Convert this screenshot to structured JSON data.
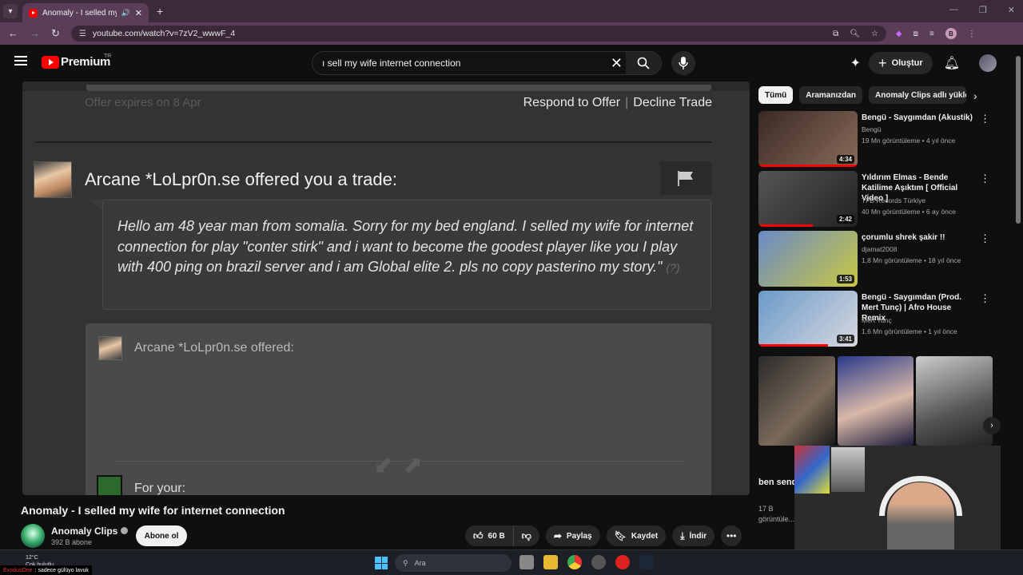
{
  "browser": {
    "tab_title": "Anomaly - I selled my wife",
    "url": "youtube.com/watch?v=7zV2_wwwF_4",
    "profile_initial": "B"
  },
  "yt": {
    "logo": "Premium",
    "region": "TR",
    "search_value": "ı sell my wife internet connection",
    "create_label": "Oluştur"
  },
  "video_frame": {
    "offer_expires": "Offer expires on 8 Apr",
    "respond": "Respond to Offer",
    "decline": "Decline Trade",
    "trade_title": "Arcane *LoLpr0n.se offered you a trade:",
    "message": "Hello am 48 year man from somalia. Sorry for my bed england. I selled my wife for internet connection for play \"conter stirk\" and i want to become the goodest player like you I play with 400 ping on brazil server and i am Global elite 2. pls no copy pasterino my story.\"",
    "message_q": "(?)",
    "offered_label": "Arcane *LoLpr0n.se offered:",
    "your_label": "For your:"
  },
  "video_info": {
    "title": "Anomaly - I selled my wife for internet connection",
    "channel": "Anomaly Clips",
    "subs": "392 B abone",
    "subscribe": "Abone ol",
    "likes": "60 B",
    "share": "Paylaş",
    "save": "Kaydet",
    "download": "İndir"
  },
  "chips": [
    "Tümü",
    "Aramanızdan",
    "Anomaly Clips adlı yükle"
  ],
  "recs": [
    {
      "title": "Bengü - Saygımdan (Akustik)",
      "channel": "Bengü",
      "meta": "19 Mn görüntüleme • 4 yıl önce",
      "duration": "4:34",
      "colors": [
        "#3a2a24",
        "#8a6a5a"
      ],
      "progress": 1.0
    },
    {
      "title": "Yıldırım Elmas - Bende Katilime Aşıktım [ Official Video ]",
      "channel": "TFB Records Türkiye",
      "meta": "40 Mn görüntüleme • 6 ay önce",
      "duration": "2:42",
      "colors": [
        "#555",
        "#222"
      ],
      "progress": 0.55
    },
    {
      "title": "çorumlu shrek şakir !!",
      "channel": "djamat2008",
      "meta": "1,8 Mn görüntüleme • 18 yıl önce",
      "duration": "1:53",
      "colors": [
        "#6a8ac8",
        "#c8c840"
      ],
      "progress": 0.0
    },
    {
      "title": "Bengü - Saygımdan (Prod. Mert Tunç) | Afro House Remix",
      "channel": "Mert Tunç",
      "meta": "1,6 Mn görüntüleme • 1 yıl önce",
      "duration": "3:41",
      "colors": [
        "#6a9ac8",
        "#d8d8e0"
      ],
      "progress": 0.7
    }
  ],
  "short": {
    "title": "ben send tutuklu ...",
    "views": "17 B",
    "meta": "görüntüle..."
  },
  "taskbar": {
    "temp": "12°C",
    "weather": "Çok bulutlu",
    "notif_user": "ExodusOne",
    "notif_text": ": sadece gülüyo lavuk",
    "search": "Ara"
  }
}
